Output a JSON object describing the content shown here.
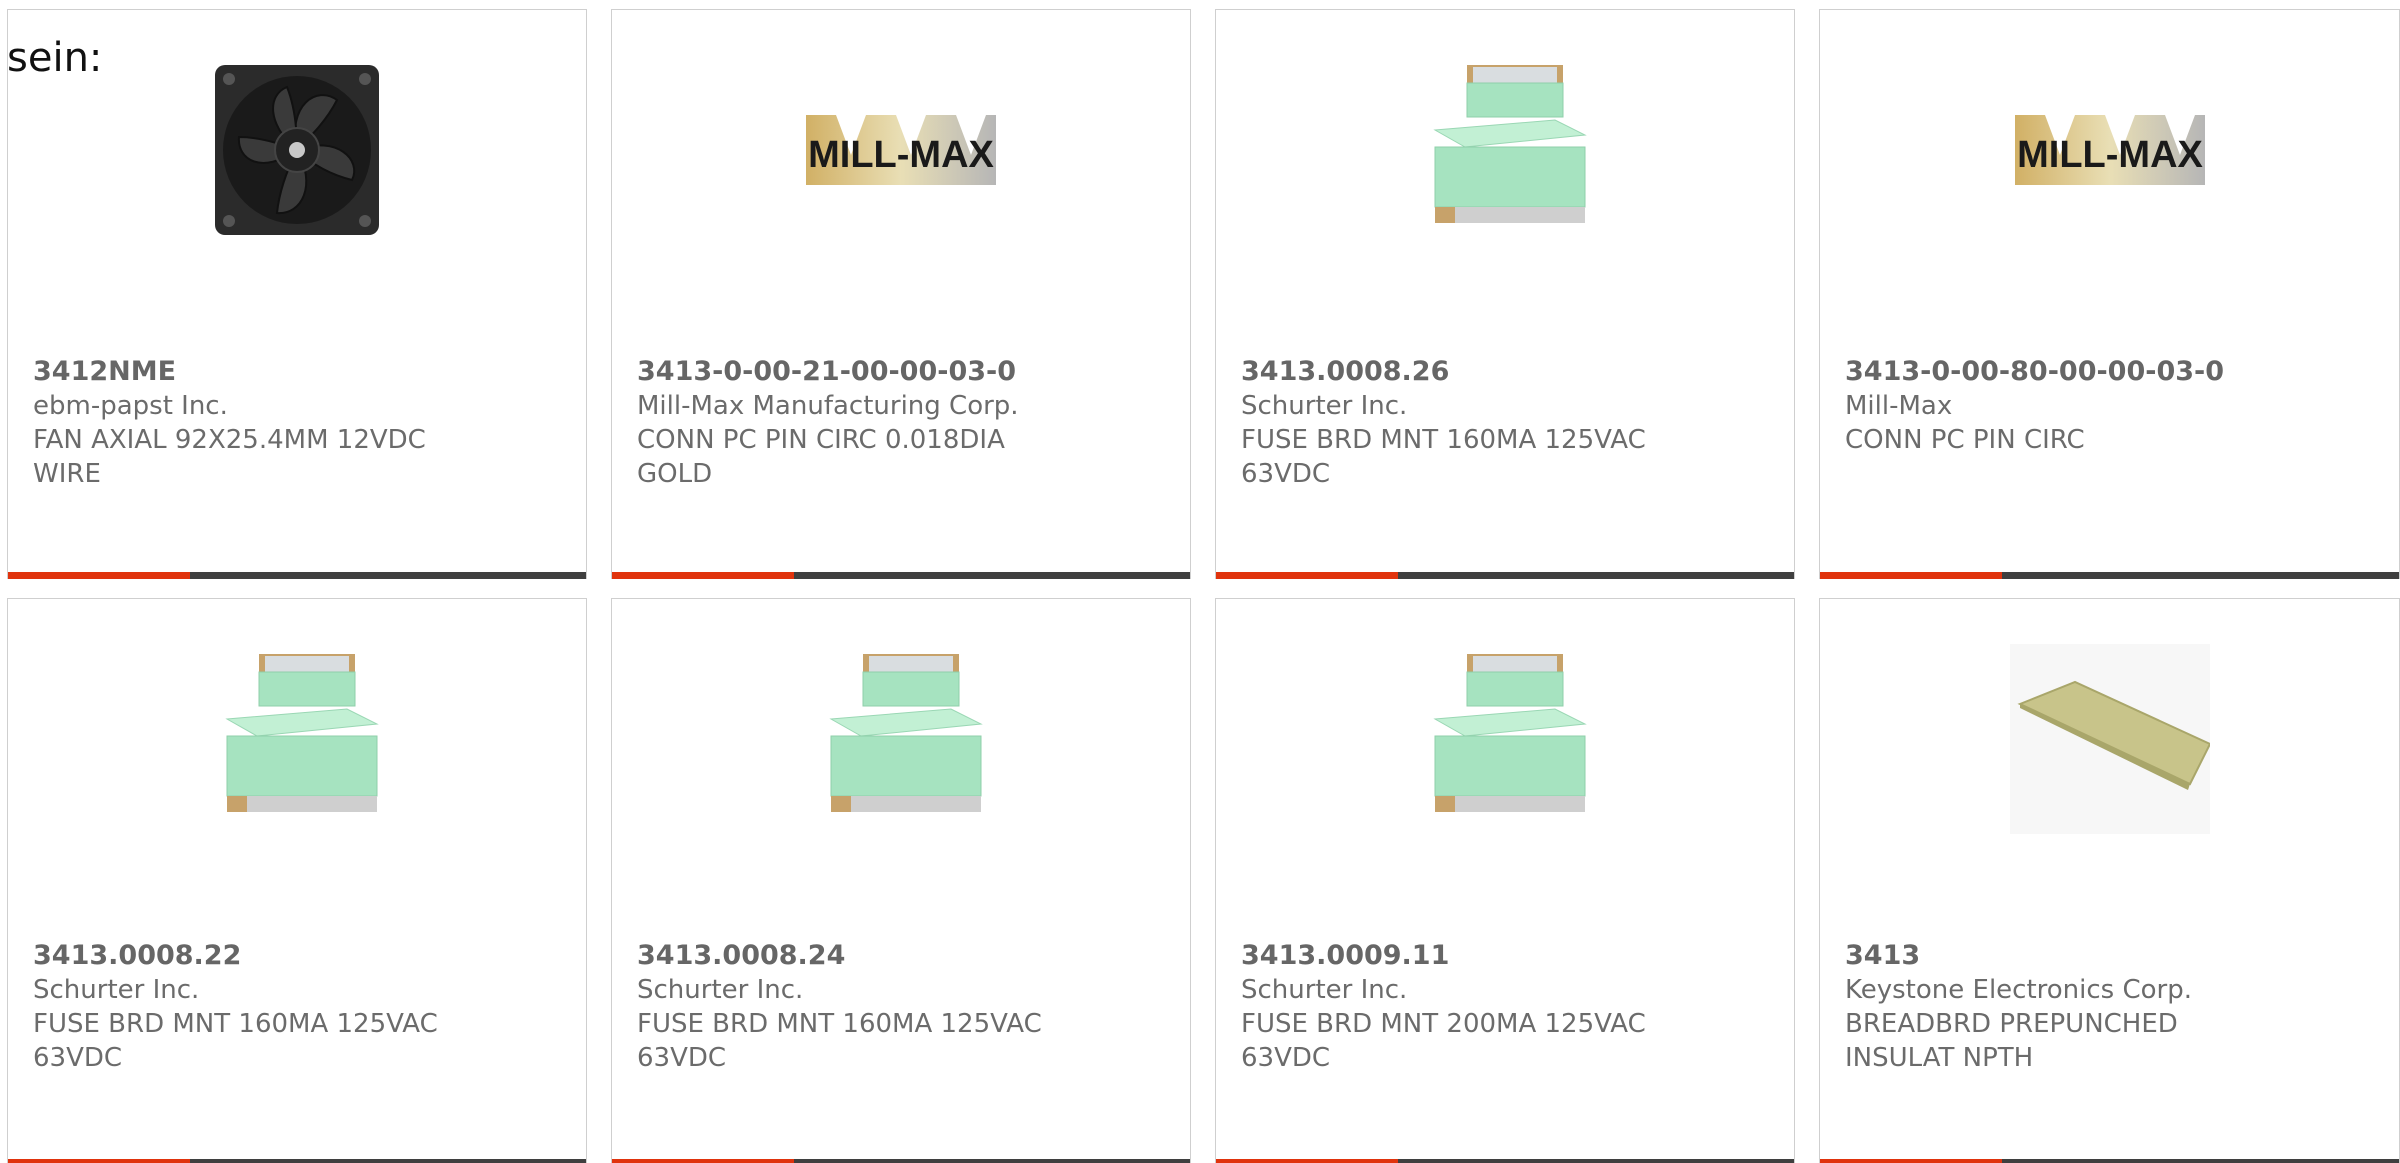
{
  "intro_text": "sein:",
  "colors": {
    "accent": "#e0330d",
    "bar": "#3f3f3f",
    "text": "#6b6b6b"
  },
  "cards": [
    {
      "part_number": "3412NME",
      "manufacturer": "ebm-papst Inc.",
      "desc1": "FAN AXIAL 92X25.4MM 12VDC",
      "desc2": "WIRE",
      "image": "fan-icon"
    },
    {
      "part_number": "3413-0-00-21-00-00-03-0",
      "manufacturer": "Mill-Max Manufacturing Corp.",
      "desc1": "CONN PC PIN CIRC 0.018DIA",
      "desc2": "GOLD",
      "image": "mill-max-logo",
      "logo_text": "MILL-MAX"
    },
    {
      "part_number": "3413.0008.26",
      "manufacturer": "Schurter Inc.",
      "desc1": "FUSE BRD MNT 160MA 125VAC",
      "desc2": "63VDC",
      "image": "fuse-icon"
    },
    {
      "part_number": "3413-0-00-80-00-00-03-0",
      "manufacturer": "Mill-Max",
      "desc1": "CONN PC PIN CIRC",
      "desc2": "",
      "image": "mill-max-logo",
      "logo_text": "MILL-MAX"
    },
    {
      "part_number": "3413.0008.22",
      "manufacturer": "Schurter Inc.",
      "desc1": "FUSE BRD MNT 160MA 125VAC",
      "desc2": "63VDC",
      "image": "fuse-icon"
    },
    {
      "part_number": "3413.0008.24",
      "manufacturer": "Schurter Inc.",
      "desc1": "FUSE BRD MNT 160MA 125VAC",
      "desc2": "63VDC",
      "image": "fuse-icon"
    },
    {
      "part_number": "3413.0009.11",
      "manufacturer": "Schurter Inc.",
      "desc1": "FUSE BRD MNT 200MA 125VAC",
      "desc2": "63VDC",
      "image": "fuse-icon"
    },
    {
      "part_number": "3413",
      "manufacturer": "Keystone Electronics Corp.",
      "desc1": "BREADBRD PREPUNCHED",
      "desc2": "INSULAT NPTH",
      "image": "breadboard-icon"
    }
  ]
}
